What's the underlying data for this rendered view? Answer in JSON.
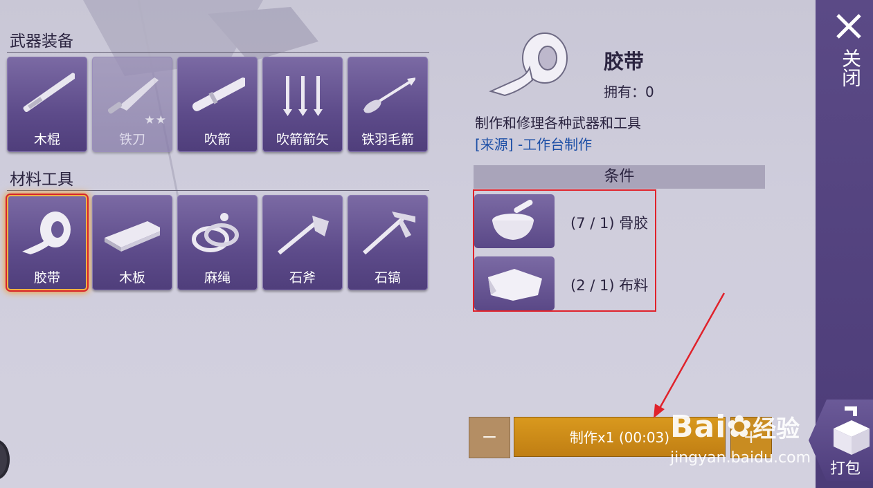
{
  "sections": {
    "weapons_title": "武器装备",
    "materials_title": "材料工具"
  },
  "weapons": [
    {
      "label": "木棍",
      "icon": "stick-icon"
    },
    {
      "label": "铁刀",
      "icon": "knife-icon",
      "stars": "★★",
      "disabled": true
    },
    {
      "label": "吹箭",
      "icon": "blowpipe-icon"
    },
    {
      "label": "吹箭箭矢",
      "icon": "darts-icon"
    },
    {
      "label": "铁羽毛箭",
      "icon": "arrow-icon"
    }
  ],
  "materials": [
    {
      "label": "胶带",
      "icon": "tape-icon",
      "selected": true
    },
    {
      "label": "木板",
      "icon": "plank-icon"
    },
    {
      "label": "麻绳",
      "icon": "rope-icon"
    },
    {
      "label": "石斧",
      "icon": "stone-axe-icon"
    },
    {
      "label": "石镐",
      "icon": "stone-pickaxe-icon"
    }
  ],
  "detail": {
    "name": "胶带",
    "owned": "拥有：0",
    "description": "制作和修理各种武器和工具",
    "source": "[来源] -工作台制作",
    "conditions_header": "条件",
    "conditions": [
      {
        "text": "(7 / 1) 骨胶",
        "icon": "bone-glue-icon"
      },
      {
        "text": "(2 / 1) 布料",
        "icon": "cloth-icon"
      }
    ]
  },
  "actions": {
    "minus": "−",
    "craft": "制作x1 (00:03)",
    "plus": "+",
    "close_label": "关闭",
    "pack_label": "打包"
  },
  "watermark": {
    "brand": "Bai",
    "brand_cn": "经验",
    "url": "jingyan.baidu.com"
  },
  "colors": {
    "tile": "#5d4b8a",
    "highlight": "#e0222b",
    "craft_button": "#c98c21",
    "source_link": "#1d4fa6"
  }
}
